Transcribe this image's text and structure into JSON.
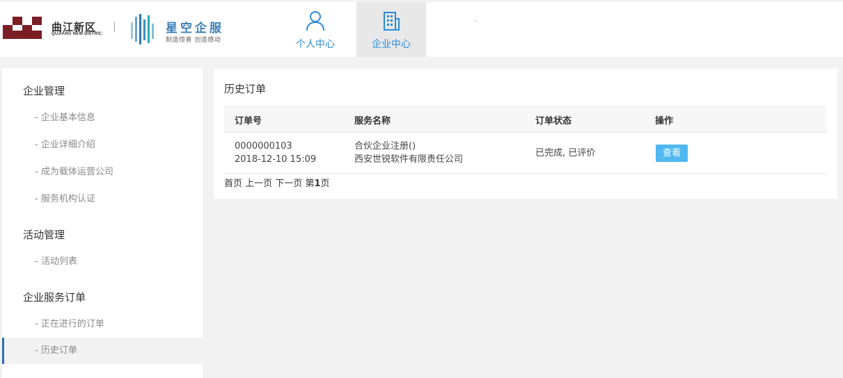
{
  "brand": {
    "qujiang_name": "曲江新区",
    "qujiang_sub": "QUJIANG NEW DISTRIC",
    "xingkong_name": "星空企服",
    "xingkong_slogan": "制造惊喜 创造感动"
  },
  "nav": {
    "tabs": [
      {
        "label": "个人中心",
        "icon": "user-icon"
      },
      {
        "label": "企业中心",
        "icon": "building-icon",
        "active": true
      }
    ]
  },
  "sidebar": {
    "groups": [
      {
        "title": "企业管理",
        "items": [
          "- 企业基本信息",
          "- 企业详细介绍",
          "- 成为载体运营公司",
          "- 服务机构认证"
        ]
      },
      {
        "title": "活动管理",
        "items": [
          "- 活动列表"
        ]
      },
      {
        "title": "企业服务订单",
        "items": [
          "- 正在进行的订单",
          "- 历史订单"
        ]
      }
    ],
    "active_item": "- 历史订单"
  },
  "main": {
    "title": "历史订单",
    "columns": [
      "订单号",
      "服务名称",
      "订单状态",
      "操作"
    ],
    "rows": [
      {
        "order_no": "0000000103",
        "datetime": "2018-12-10 15:09",
        "service_name": "合伙企业注册()",
        "company": "西安世锐软件有限责任公司",
        "status": "已完成, 已评价",
        "action": "查看"
      }
    ],
    "pager": {
      "first": "首页",
      "prev": "上一页",
      "next": "下一页",
      "page_prefix": "第",
      "page_num": "1",
      "page_suffix": "页"
    }
  },
  "colors": {
    "accent": "#2b8ad8",
    "button": "#4fb8f0",
    "active_bar": "#2f6fb5"
  }
}
